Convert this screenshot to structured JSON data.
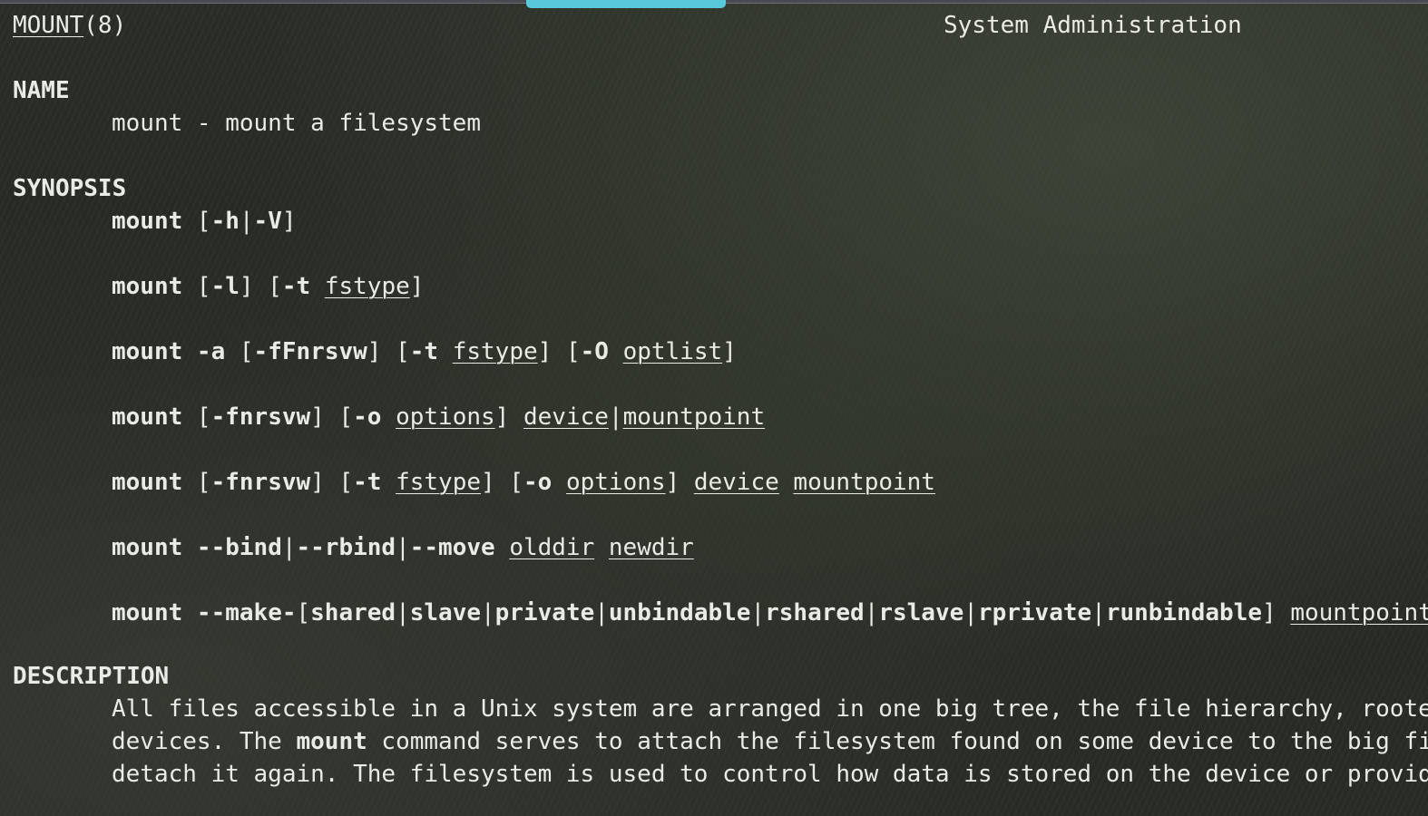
{
  "header": {
    "page_name": "MOUNT",
    "section": "(8)",
    "center_title": "System Administration"
  },
  "sections": {
    "name": {
      "heading": "NAME",
      "text": "mount - mount a filesystem"
    },
    "synopsis": {
      "heading": "SYNOPSIS",
      "lines": [
        {
          "parts": [
            {
              "text": "mount ",
              "style": "b"
            },
            {
              "text": "[",
              "style": ""
            },
            {
              "text": "-h",
              "style": "b"
            },
            {
              "text": "|",
              "style": ""
            },
            {
              "text": "-V",
              "style": "b"
            },
            {
              "text": "]",
              "style": ""
            }
          ]
        },
        {
          "parts": [
            {
              "text": "mount ",
              "style": "b"
            },
            {
              "text": "[",
              "style": ""
            },
            {
              "text": "-l",
              "style": "b"
            },
            {
              "text": "] [",
              "style": ""
            },
            {
              "text": "-t ",
              "style": "b"
            },
            {
              "text": "fstype",
              "style": "u"
            },
            {
              "text": "]",
              "style": ""
            }
          ]
        },
        {
          "parts": [
            {
              "text": "mount -a ",
              "style": "b"
            },
            {
              "text": "[",
              "style": ""
            },
            {
              "text": "-fFnrsvw",
              "style": "b"
            },
            {
              "text": "] [",
              "style": ""
            },
            {
              "text": "-t ",
              "style": "b"
            },
            {
              "text": "fstype",
              "style": "u"
            },
            {
              "text": "] [",
              "style": ""
            },
            {
              "text": "-O ",
              "style": "b"
            },
            {
              "text": "optlist",
              "style": "u"
            },
            {
              "text": "]",
              "style": ""
            }
          ]
        },
        {
          "parts": [
            {
              "text": "mount ",
              "style": "b"
            },
            {
              "text": "[",
              "style": ""
            },
            {
              "text": "-fnrsvw",
              "style": "b"
            },
            {
              "text": "] [",
              "style": ""
            },
            {
              "text": "-o ",
              "style": "b"
            },
            {
              "text": "options",
              "style": "u"
            },
            {
              "text": "] ",
              "style": ""
            },
            {
              "text": "device",
              "style": "u"
            },
            {
              "text": "|",
              "style": ""
            },
            {
              "text": "mountpoint",
              "style": "u"
            }
          ]
        },
        {
          "parts": [
            {
              "text": "mount ",
              "style": "b"
            },
            {
              "text": "[",
              "style": ""
            },
            {
              "text": "-fnrsvw",
              "style": "b"
            },
            {
              "text": "] [",
              "style": ""
            },
            {
              "text": "-t ",
              "style": "b"
            },
            {
              "text": "fstype",
              "style": "u"
            },
            {
              "text": "] [",
              "style": ""
            },
            {
              "text": "-o ",
              "style": "b"
            },
            {
              "text": "options",
              "style": "u"
            },
            {
              "text": "] ",
              "style": ""
            },
            {
              "text": "device",
              "style": "u"
            },
            {
              "text": " ",
              "style": ""
            },
            {
              "text": "mountpoint",
              "style": "u"
            }
          ]
        },
        {
          "parts": [
            {
              "text": "mount ",
              "style": "b"
            },
            {
              "text": "--bind",
              "style": "b"
            },
            {
              "text": "|",
              "style": ""
            },
            {
              "text": "--rbind",
              "style": "b"
            },
            {
              "text": "|",
              "style": ""
            },
            {
              "text": "--move ",
              "style": "b"
            },
            {
              "text": "olddir",
              "style": "u"
            },
            {
              "text": " ",
              "style": ""
            },
            {
              "text": "newdir",
              "style": "u"
            }
          ]
        },
        {
          "parts": [
            {
              "text": "mount ",
              "style": "b"
            },
            {
              "text": "--make-",
              "style": "b"
            },
            {
              "text": "[",
              "style": ""
            },
            {
              "text": "shared",
              "style": "b"
            },
            {
              "text": "|",
              "style": ""
            },
            {
              "text": "slave",
              "style": "b"
            },
            {
              "text": "|",
              "style": ""
            },
            {
              "text": "private",
              "style": "b"
            },
            {
              "text": "|",
              "style": ""
            },
            {
              "text": "unbindable",
              "style": "b"
            },
            {
              "text": "|",
              "style": ""
            },
            {
              "text": "rshared",
              "style": "b"
            },
            {
              "text": "|",
              "style": ""
            },
            {
              "text": "rslave",
              "style": "b"
            },
            {
              "text": "|",
              "style": ""
            },
            {
              "text": "rprivate",
              "style": "b"
            },
            {
              "text": "|",
              "style": ""
            },
            {
              "text": "runbindable",
              "style": "b"
            },
            {
              "text": "] ",
              "style": ""
            },
            {
              "text": "mountpoint",
              "style": "u"
            }
          ]
        }
      ]
    },
    "description": {
      "heading": "DESCRIPTION",
      "lines": [
        {
          "parts": [
            {
              "text": "All files accessible in a Unix system are arranged in one big tree, the file hierarchy, roote",
              "style": ""
            }
          ]
        },
        {
          "parts": [
            {
              "text": "devices. The ",
              "style": ""
            },
            {
              "text": "mount",
              "style": "b"
            },
            {
              "text": " command serves to attach the filesystem found on some device to the big fi",
              "style": ""
            }
          ]
        },
        {
          "parts": [
            {
              "text": "detach it again. The filesystem is used to control how data is stored on the device or provid",
              "style": ""
            }
          ]
        }
      ]
    }
  },
  "colors": {
    "text": "#e9ebe5",
    "scroll_indicator": "#57c9da",
    "background": "#2a2d27"
  }
}
